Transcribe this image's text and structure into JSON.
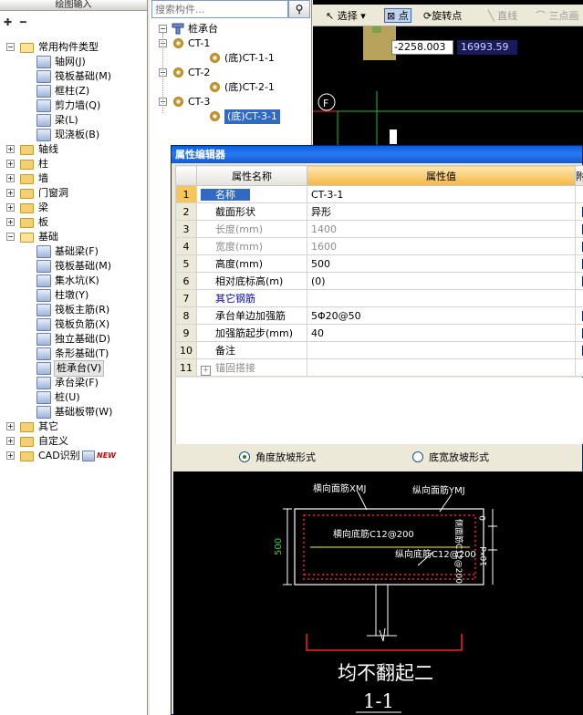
{
  "left_panel": {
    "title": "绘图输入",
    "tree": [
      {
        "label": "常用构件类型",
        "type": "folder-open"
      },
      {
        "label": "轴网(J)"
      },
      {
        "label": "筏板基础(M)"
      },
      {
        "label": "框柱(Z)"
      },
      {
        "label": "剪力墙(Q)"
      },
      {
        "label": "梁(L)"
      },
      {
        "label": "现浇板(B)"
      },
      {
        "label": "轴线",
        "type": "folder"
      },
      {
        "label": "柱",
        "type": "folder"
      },
      {
        "label": "墙",
        "type": "folder"
      },
      {
        "label": "门窗洞",
        "type": "folder"
      },
      {
        "label": "梁",
        "type": "folder"
      },
      {
        "label": "板",
        "type": "folder"
      },
      {
        "label": "基础",
        "type": "folder-open"
      },
      {
        "label": "基础梁(F)"
      },
      {
        "label": "筏板基础(M)"
      },
      {
        "label": "集水坑(K)"
      },
      {
        "label": "柱墩(Y)"
      },
      {
        "label": "筏板主筋(R)"
      },
      {
        "label": "筏板负筋(X)"
      },
      {
        "label": "独立基础(D)"
      },
      {
        "label": "条形基础(T)"
      },
      {
        "label": "桩承台(V)",
        "selected": true
      },
      {
        "label": "承台梁(F)"
      },
      {
        "label": "桩(U)"
      },
      {
        "label": "基础板带(W)"
      },
      {
        "label": "其它",
        "type": "folder"
      },
      {
        "label": "自定义",
        "type": "folder"
      },
      {
        "label": "CAD识别",
        "type": "folder"
      }
    ],
    "new_badge": "NEW"
  },
  "mid_panel": {
    "search_placeholder": "搜索构件...",
    "root": "桩承台",
    "items": [
      {
        "label": "CT-1",
        "level": 1
      },
      {
        "label": "(底)CT-1-1",
        "level": 2
      },
      {
        "label": "CT-2",
        "level": 1
      },
      {
        "label": "(底)CT-2-1",
        "level": 2
      },
      {
        "label": "CT-3",
        "level": 1
      },
      {
        "label": "(底)CT-3-1",
        "level": 2,
        "selected": true
      }
    ]
  },
  "canvas_toolbar": {
    "select": "选择",
    "point": "点",
    "rotate_point": "旋转点",
    "line": "直线",
    "three_point": "三点画"
  },
  "canvas": {
    "coord_x": "-2258.003",
    "coord_y": "16993.59",
    "axis_label": "F"
  },
  "prop_editor": {
    "title": "属性编辑器",
    "col_name": "属性名称",
    "col_value": "属性值",
    "col_extra": "附",
    "rows": [
      {
        "num": "1",
        "name": "名称",
        "value": "CT-3-1",
        "style": "selected",
        "ext": false
      },
      {
        "num": "2",
        "name": "截面形状",
        "value": "异形",
        "style": "",
        "ext": true
      },
      {
        "num": "3",
        "name": "长度(mm)",
        "value": "1400",
        "style": "gray",
        "ext": true
      },
      {
        "num": "4",
        "name": "宽度(mm)",
        "value": "1600",
        "style": "gray",
        "ext": true
      },
      {
        "num": "5",
        "name": "高度(mm)",
        "value": "500",
        "style": "",
        "ext": true
      },
      {
        "num": "6",
        "name": "相对底标高(m)",
        "value": "(0)",
        "style": "",
        "ext": true
      },
      {
        "num": "7",
        "name": "其它钢筋",
        "value": "",
        "style": "blue",
        "ext": false
      },
      {
        "num": "8",
        "name": "承台单边加强筋",
        "value": "5Φ20@50",
        "style": "",
        "ext": true
      },
      {
        "num": "9",
        "name": "加强筋起步(mm)",
        "value": "40",
        "style": "",
        "ext": true
      },
      {
        "num": "10",
        "name": "备注",
        "value": "",
        "style": "",
        "ext": true
      },
      {
        "num": "11",
        "name": "锚固搭接",
        "value": "",
        "style": "gray-expand",
        "ext": false
      }
    ],
    "slope_angle": "角度放坡形式",
    "slope_width": "底宽放坡形式"
  },
  "section_view": {
    "top_transverse": "横向面筋XMJ",
    "top_longitudinal": "纵向面筋YMJ",
    "bottom_transverse": "横向底筋C12@200",
    "bottom_longitudinal": "纵向底筋C12@200",
    "side_rebar": "侧面筋C12@200",
    "height_label": "500",
    "dim_zero": "0",
    "dim_10d": "10*d",
    "caption": "均不翻起二",
    "section_no": "1-1"
  },
  "colors": {
    "selection_blue": "#316ac5",
    "title_blue": "#0a5de0",
    "value_header_orange": "#f5b640",
    "cad_red": "#ff2020",
    "cad_green": "#20e020",
    "cad_yellow": "#ffff00"
  }
}
